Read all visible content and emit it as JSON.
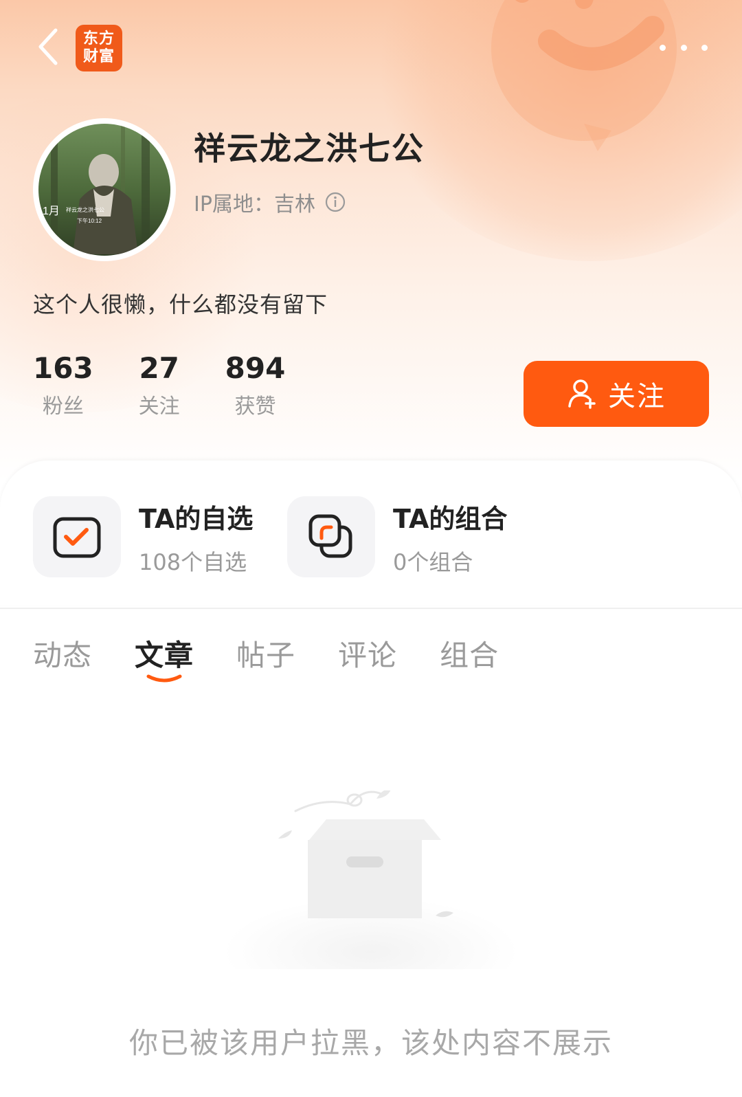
{
  "header": {
    "app_logo_line1": "东方",
    "app_logo_line2": "财富",
    "back_icon": "chevron-left-icon",
    "more_icon": "more-horizontal-icon"
  },
  "profile": {
    "name": "祥云龙之洪七公",
    "ip_location": "IP属地：吉林",
    "bio": "这个人很懒，什么都没有留下",
    "avatar_caption_month": "1月",
    "avatar_caption_name": "祥云龙之洪七公",
    "avatar_caption_time": "下午10:12"
  },
  "stats": [
    {
      "value": "163",
      "label": "粉丝"
    },
    {
      "value": "27",
      "label": "关注"
    },
    {
      "value": "894",
      "label": "获赞"
    }
  ],
  "follow_button": {
    "label": "关注"
  },
  "features": [
    {
      "title": "TA的自选",
      "subtitle": "108个自选",
      "icon": "checkbox-icon"
    },
    {
      "title": "TA的组合",
      "subtitle": "0个组合",
      "icon": "portfolio-icon"
    }
  ],
  "tabs": [
    {
      "label": "动态",
      "active": false
    },
    {
      "label": "文章",
      "active": true
    },
    {
      "label": "帖子",
      "active": false
    },
    {
      "label": "评论",
      "active": false
    },
    {
      "label": "组合",
      "active": false
    }
  ],
  "empty_state": {
    "message": "你已被该用户拉黑，该处内容不展示"
  },
  "colors": {
    "accent": "#ff5a10",
    "brand": "#f05a1a",
    "text_primary": "#222222",
    "text_secondary": "#9a9a9a"
  }
}
